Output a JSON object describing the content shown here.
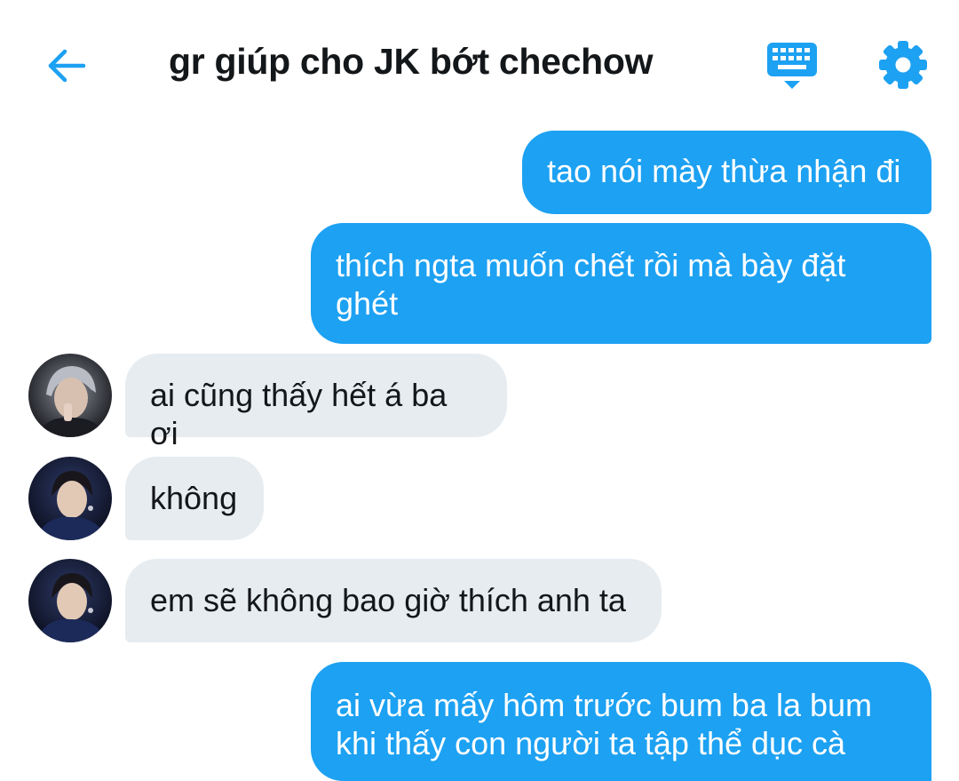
{
  "header": {
    "title": "gr giúp cho JK bớt chechow",
    "icons": {
      "back": "arrow-left-icon",
      "keyboard": "keyboard-icon",
      "settings": "gear-icon"
    },
    "accent_color": "#1da1f2"
  },
  "messages": [
    {
      "direction": "outgoing",
      "lines": [
        "tao nói mày thừa nhận đi"
      ]
    },
    {
      "direction": "outgoing",
      "lines": [
        "thích ngta muốn chết rồi mà bày đặt",
        "ghét"
      ]
    },
    {
      "direction": "incoming",
      "lines": [
        "ai cũng thấy hết á ba ơi"
      ]
    },
    {
      "direction": "incoming",
      "lines": [
        "không"
      ]
    },
    {
      "direction": "incoming",
      "lines": [
        "em sẽ không bao giờ thích anh ta"
      ]
    },
    {
      "direction": "outgoing",
      "lines": [
        "ai vừa mấy hôm trước bum ba la bum",
        "khi thấy con người ta tập thể dục cà"
      ]
    }
  ],
  "colors": {
    "outgoing_bubble": "#1da1f2",
    "incoming_bubble": "#e6ecf0",
    "incoming_text": "#14171a",
    "outgoing_text": "#ffffff"
  }
}
